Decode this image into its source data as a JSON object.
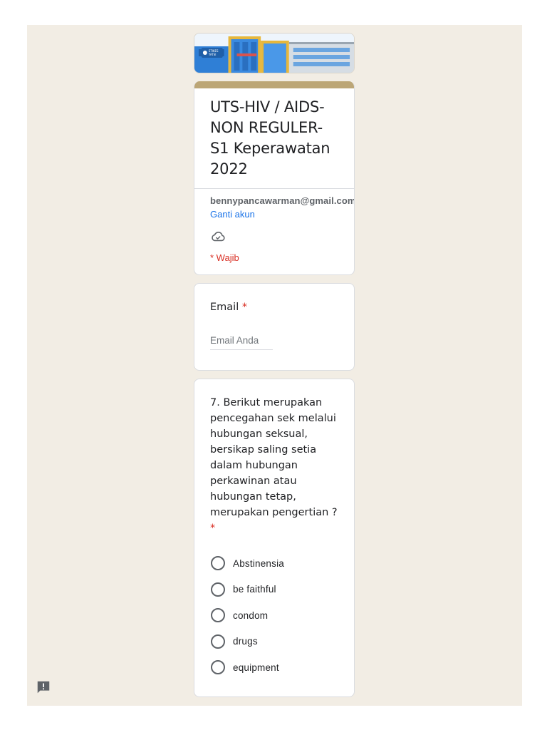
{
  "form": {
    "title": "UTS-HIV / AIDS-NON REGULER-S1 Keperawatan 2022",
    "account_email": "bennypancawarman@gmail.com",
    "switch_account_label": "Ganti akun",
    "required_note": "* Wajib"
  },
  "banner": {
    "sign_text": "STIKES YATSI",
    "image_description": "building-illustration"
  },
  "questions": [
    {
      "label": "Email",
      "required_mark": "*",
      "input_placeholder": "Email Anda",
      "input_value": ""
    },
    {
      "label": "7. Berikut merupakan pencegahan sek melalui hubungan seksual, bersikap saling setia dalam hubungan perkawinan atau hubungan tetap, merupakan pengertian ?",
      "required_mark": "*",
      "options": [
        "Abstinensia",
        "be faithful",
        "condom",
        "drugs",
        "equipment"
      ],
      "selected": null
    }
  ],
  "icons": {
    "cloud": "cloud-saved-icon",
    "feedback": "report-feedback-icon"
  },
  "colors": {
    "accent": "#bca676",
    "background": "#f2ede4",
    "link": "#1a73e8",
    "required": "#d93025"
  }
}
